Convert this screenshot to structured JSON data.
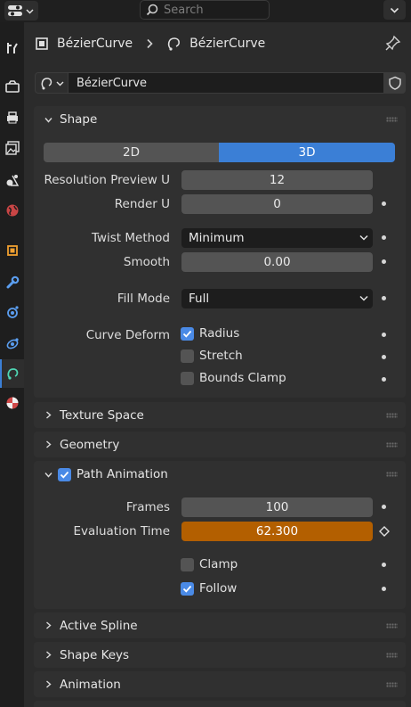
{
  "header": {
    "search_placeholder": "Search"
  },
  "breadcrumb": {
    "object": "BézierCurve",
    "data": "BézierCurve"
  },
  "datablock": {
    "name": "BézierCurve"
  },
  "panels": {
    "shape": {
      "title": "Shape",
      "dim_options": [
        "2D",
        "3D"
      ],
      "dim_selected": "3D",
      "resolution_preview_label": "Resolution Preview U",
      "resolution_preview_value": "12",
      "render_label": "Render U",
      "render_value": "0",
      "twist_method_label": "Twist Method",
      "twist_method_value": "Minimum",
      "smooth_label": "Smooth",
      "smooth_value": "0.00",
      "fill_mode_label": "Fill Mode",
      "fill_mode_value": "Full",
      "curve_deform_label": "Curve Deform",
      "radius_label": "Radius",
      "radius_checked": true,
      "stretch_label": "Stretch",
      "stretch_checked": false,
      "bounds_clamp_label": "Bounds Clamp",
      "bounds_clamp_checked": false
    },
    "texture_space": {
      "title": "Texture Space"
    },
    "geometry": {
      "title": "Geometry"
    },
    "path_animation": {
      "title": "Path Animation",
      "enabled": true,
      "frames_label": "Frames",
      "frames_value": "100",
      "evaluation_time_label": "Evaluation Time",
      "evaluation_time_value": "62.300",
      "clamp_label": "Clamp",
      "clamp_checked": false,
      "follow_label": "Follow",
      "follow_checked": true
    },
    "active_spline": {
      "title": "Active Spline"
    },
    "shape_keys": {
      "title": "Shape Keys"
    },
    "animation": {
      "title": "Animation"
    }
  },
  "colors": {
    "accent_blue": "#3b7fd6",
    "keyframed_orange": "#b35f00",
    "checkbox_on": "#4a8ae6"
  }
}
